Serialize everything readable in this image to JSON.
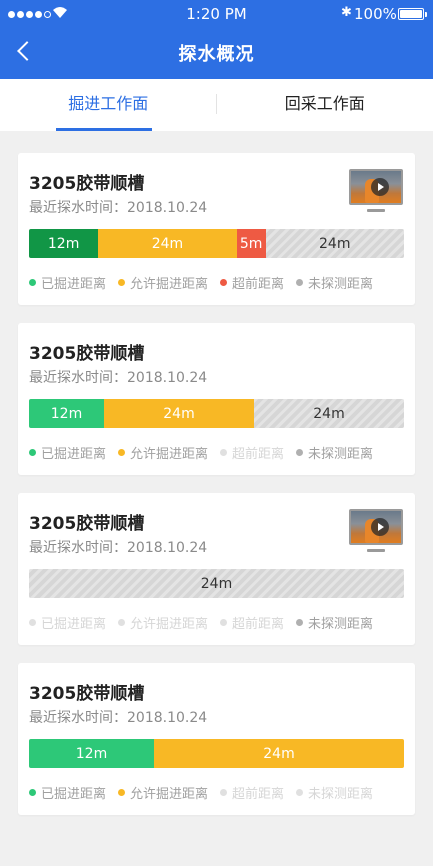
{
  "status_bar": {
    "time": "1:20 PM",
    "battery": "100%",
    "bluetooth": "✱"
  },
  "nav": {
    "title": "探水概况",
    "back_icon": "chevron-left-icon"
  },
  "tabs": [
    {
      "label": "掘进工作面",
      "active": true
    },
    {
      "label": "回采工作面",
      "active": false
    }
  ],
  "colors": {
    "primary": "#2d6fe3",
    "excavated_dark": "#119646",
    "excavated": "#2dc878",
    "allowed": "#f8b825",
    "overrun": "#ee5a43",
    "unexplored": "#d6d6d6",
    "legend_excavated": "#2dc878",
    "legend_allowed": "#f8b825",
    "legend_overrun": "#ee5a43",
    "legend_unexplored": "#b0b0b0"
  },
  "legend_labels": [
    "已掘进距离",
    "允许掘进距离",
    "超前距离",
    "未探测距离"
  ],
  "cards": [
    {
      "title": "3205胶带顺槽",
      "time": "最近探水时间：2018.10.24",
      "has_video": true,
      "segments": [
        {
          "label": "12m",
          "value": 12,
          "kind": "dark-green"
        },
        {
          "label": "24m",
          "value": 24,
          "kind": "yellow"
        },
        {
          "label": "5m",
          "value": 5,
          "kind": "red"
        },
        {
          "label": "24m",
          "value": 24,
          "kind": "gray"
        }
      ],
      "legend_active": [
        true,
        true,
        true,
        true
      ]
    },
    {
      "title": "3205胶带顺槽",
      "time": "最近探水时间：2018.10.24",
      "has_video": false,
      "segments": [
        {
          "label": "12m",
          "value": 12,
          "kind": "green"
        },
        {
          "label": "24m",
          "value": 24,
          "kind": "yellow"
        },
        {
          "label": "24m",
          "value": 24,
          "kind": "gray"
        }
      ],
      "legend_active": [
        true,
        true,
        false,
        true
      ]
    },
    {
      "title": "3205胶带顺槽",
      "time": "最近探水时间：2018.10.24",
      "has_video": true,
      "segments": [
        {
          "label": "24m",
          "value": 24,
          "kind": "gray"
        }
      ],
      "legend_active": [
        false,
        false,
        false,
        true
      ]
    },
    {
      "title": "3205胶带顺槽",
      "time": "最近探水时间：2018.10.24",
      "has_video": false,
      "segments": [
        {
          "label": "12m",
          "value": 12,
          "kind": "green"
        },
        {
          "label": "24m",
          "value": 24,
          "kind": "yellow"
        }
      ],
      "legend_active": [
        true,
        true,
        false,
        false
      ]
    }
  ]
}
